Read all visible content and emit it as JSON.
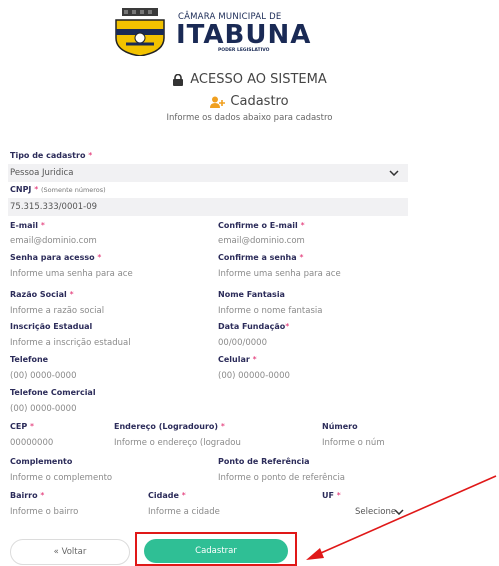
{
  "header": {
    "org_name": "CÂMARA MUNICIPAL DE",
    "city_name": "ITABUNA",
    "subtitle": "PODER LEGISLATIVO"
  },
  "page": {
    "section_title": "ACESSO AO SISTEMA",
    "sub_title": "Cadastro",
    "instructions": "Informe os dados abaixo para cadastro"
  },
  "form": {
    "tipo": {
      "label": "Tipo de cadastro",
      "value": "Pessoa Juridica"
    },
    "cnpj": {
      "label": "CNPJ",
      "hint": "(Somente números)",
      "value": "75.315.333/0001-09"
    },
    "email": {
      "label": "E-mail",
      "placeholder": "email@dominio.com"
    },
    "email_confirm": {
      "label": "Confirme o E-mail",
      "placeholder": "email@dominio.com"
    },
    "senha": {
      "label": "Senha para acesso",
      "placeholder": "Informe uma senha para ace"
    },
    "senha_confirm": {
      "label": "Confirme a senha",
      "placeholder": "Informe uma senha para ace"
    },
    "razao": {
      "label": "Razão Social",
      "placeholder": "Informe a razão social"
    },
    "fantasia": {
      "label": "Nome Fantasia",
      "placeholder": "Informe o nome fantasia"
    },
    "inscricao": {
      "label": "Inscrição Estadual",
      "placeholder": "Informe a inscrição estadual"
    },
    "fundacao": {
      "label": "Data Fundação",
      "placeholder": "00/00/0000"
    },
    "telefone": {
      "label": "Telefone",
      "placeholder": "(00) 0000-0000"
    },
    "celular": {
      "label": "Celular",
      "placeholder": "(00) 00000-0000"
    },
    "tel_comercial": {
      "label": "Telefone Comercial",
      "placeholder": "(00) 0000-0000"
    },
    "cep": {
      "label": "CEP",
      "placeholder": "00000000"
    },
    "endereco": {
      "label": "Endereço (Logradouro)",
      "placeholder": "Informe o endereço (logradou"
    },
    "numero": {
      "label": "Número",
      "placeholder": "Informe o núm"
    },
    "complemento": {
      "label": "Complemento",
      "placeholder": "Informe o complemento"
    },
    "referencia": {
      "label": "Ponto de Referência",
      "placeholder": "Informe o ponto de referência"
    },
    "bairro": {
      "label": "Bairro",
      "placeholder": "Informe o bairro"
    },
    "cidade": {
      "label": "Cidade",
      "placeholder": "Informe a cidade"
    },
    "uf": {
      "label": "UF",
      "value": "Selecione"
    },
    "required_mark": "*"
  },
  "buttons": {
    "back": "« Voltar",
    "submit": "Cadastrar"
  },
  "colors": {
    "accent": "#2fbf95",
    "required": "#e0246a",
    "label": "#2c2c5a",
    "highlight": "#e01818"
  }
}
